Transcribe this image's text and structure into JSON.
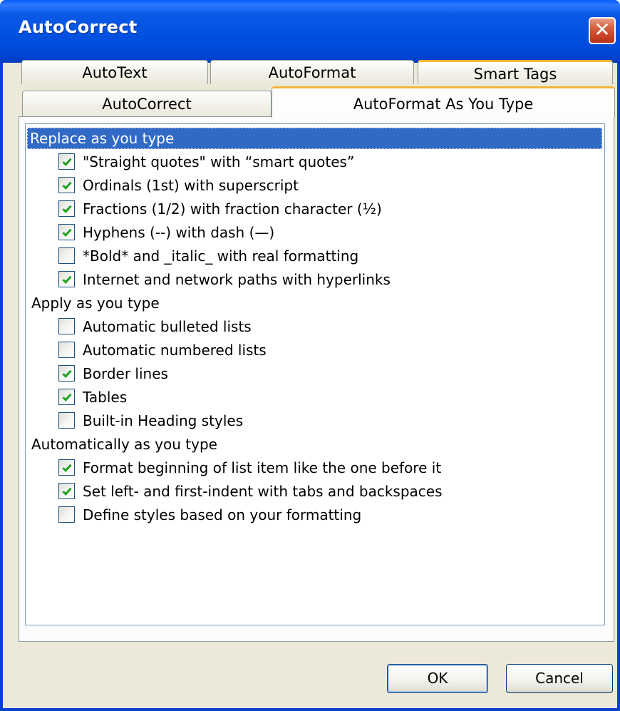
{
  "window": {
    "title": "AutoCorrect",
    "close_icon": "close-icon",
    "close_symbol": "✕"
  },
  "tabs": {
    "back_row": [
      "AutoText",
      "AutoFormat",
      "Smart Tags"
    ],
    "front_row": [
      "AutoCorrect",
      "AutoFormat As You Type"
    ],
    "active": "AutoFormat As You Type"
  },
  "sections": [
    {
      "title": "Replace as you type",
      "selected": true,
      "items": [
        {
          "label": "\"Straight quotes\" with “smart quotes”",
          "checked": true
        },
        {
          "label": "Ordinals (1st) with superscript",
          "checked": true
        },
        {
          "label": "Fractions (1/2) with fraction character (½)",
          "checked": true
        },
        {
          "label": "Hyphens (--) with dash (—)",
          "checked": true
        },
        {
          "label": "*Bold* and _italic_ with real formatting",
          "checked": false
        },
        {
          "label": "Internet and network paths with hyperlinks",
          "checked": true
        }
      ]
    },
    {
      "title": "Apply as you type",
      "selected": false,
      "items": [
        {
          "label": "Automatic bulleted lists",
          "checked": false
        },
        {
          "label": "Automatic numbered lists",
          "checked": false
        },
        {
          "label": "Border lines",
          "checked": true
        },
        {
          "label": "Tables",
          "checked": true
        },
        {
          "label": "Built-in Heading styles",
          "checked": false
        }
      ]
    },
    {
      "title": "Automatically as you type",
      "selected": false,
      "items": [
        {
          "label": "Format beginning of list item like the one before it",
          "checked": true
        },
        {
          "label": "Set left- and first-indent with tabs and backspaces",
          "checked": true
        },
        {
          "label": "Define styles based on your formatting",
          "checked": false
        }
      ]
    }
  ],
  "buttons": {
    "ok": "OK",
    "cancel": "Cancel"
  },
  "colors": {
    "title_bar": "#0050e0",
    "selection": "#316ac5",
    "check": "#21a121",
    "tab_highlight": "#f4b53b"
  }
}
